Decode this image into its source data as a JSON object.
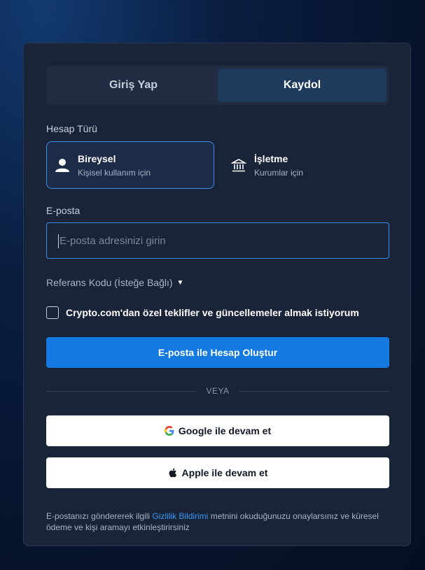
{
  "tabs": {
    "login": "Giriş Yap",
    "signup": "Kaydol"
  },
  "account_type": {
    "label": "Hesap Türü",
    "individual": {
      "title": "Bireysel",
      "subtitle": "Kişisel kullanım için"
    },
    "business": {
      "title": "İşletme",
      "subtitle": "Kurumlar için"
    }
  },
  "email": {
    "label": "E-posta",
    "placeholder": "E-posta adresinizi girin",
    "value": ""
  },
  "referral": {
    "label": "Referans Kodu (İsteğe Bağlı)"
  },
  "offers_checkbox": {
    "label": "Crypto.com'dan özel teklifler ve güncellemeler almak istiyorum",
    "checked": false
  },
  "create_button": "E-posta ile Hesap Oluştur",
  "divider_text": "VEYA",
  "google_button": "Google ile devam et",
  "apple_button": "Apple ile devam et",
  "legal": {
    "before": "E-postanızı göndererek ilgili ",
    "link": "Gizlilik Bildirimi",
    "after": " metnini okuduğunuzu onaylarsınız ve küresel ödeme ve kişi aramayı etkinleştirirsiniz"
  },
  "colors": {
    "accent": "#1479e0",
    "card_bg": "#1a2438",
    "link": "#3a95f0"
  }
}
